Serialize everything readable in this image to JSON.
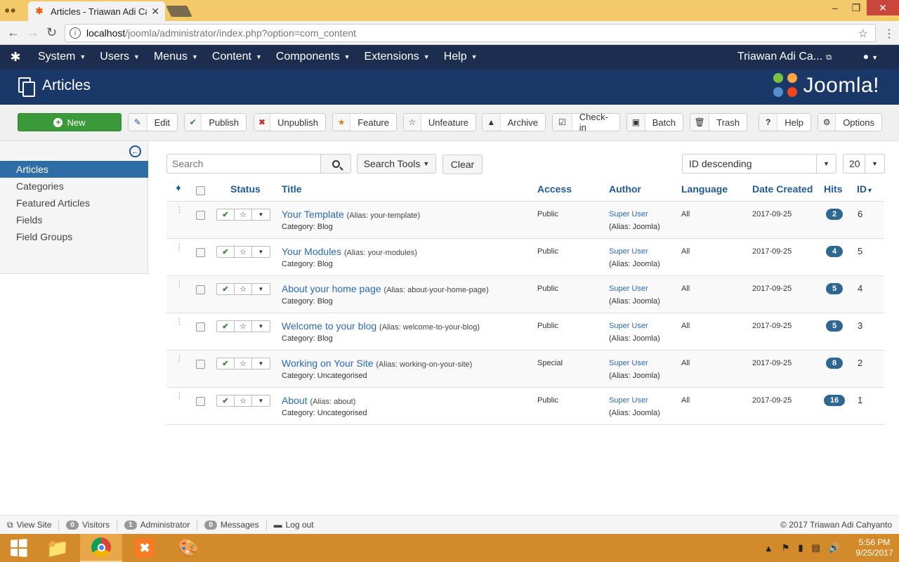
{
  "browser": {
    "tab_title": "Articles - Triawan Adi Ca",
    "url_host": "localhost",
    "url_path": "/joomla/administrator/index.php?option=com_content"
  },
  "topnav": {
    "menus": [
      "System",
      "Users",
      "Menus",
      "Content",
      "Components",
      "Extensions",
      "Help"
    ],
    "user": "Triawan Adi Ca..."
  },
  "header": {
    "title": "Articles",
    "brand": "Joomla!"
  },
  "toolbar": {
    "new": "New",
    "edit": "Edit",
    "publish": "Publish",
    "unpublish": "Unpublish",
    "feature": "Feature",
    "unfeature": "Unfeature",
    "archive": "Archive",
    "checkin": "Check-in",
    "batch": "Batch",
    "trash": "Trash",
    "help": "Help",
    "options": "Options"
  },
  "sidebar": {
    "items": [
      "Articles",
      "Categories",
      "Featured Articles",
      "Fields",
      "Field Groups"
    ],
    "active": "Articles"
  },
  "filters": {
    "search_placeholder": "Search",
    "search_tools": "Search Tools",
    "clear": "Clear",
    "sort": "ID descending",
    "limit": "20"
  },
  "table": {
    "headers": {
      "status": "Status",
      "title": "Title",
      "access": "Access",
      "author": "Author",
      "language": "Language",
      "date": "Date Created",
      "hits": "Hits",
      "id": "ID"
    },
    "rows": [
      {
        "title": "Your Template",
        "alias": "(Alias: your-template)",
        "category": "Category: Blog",
        "access": "Public",
        "author": "Super User",
        "author_alias": "(Alias: Joomla)",
        "language": "All",
        "date": "2017-09-25",
        "hits": "2",
        "id": "6"
      },
      {
        "title": "Your Modules",
        "alias": "(Alias: your-modules)",
        "category": "Category: Blog",
        "access": "Public",
        "author": "Super User",
        "author_alias": "(Alias: Joomla)",
        "language": "All",
        "date": "2017-09-25",
        "hits": "4",
        "id": "5"
      },
      {
        "title": "About your home page",
        "alias": "(Alias: about-your-home-page)",
        "category": "Category: Blog",
        "access": "Public",
        "author": "Super User",
        "author_alias": "(Alias: Joomla)",
        "language": "All",
        "date": "2017-09-25",
        "hits": "5",
        "id": "4"
      },
      {
        "title": "Welcome to your blog",
        "alias": "(Alias: welcome-to-your-blog)",
        "category": "Category: Blog",
        "access": "Public",
        "author": "Super User",
        "author_alias": "(Alias: Joomla)",
        "language": "All",
        "date": "2017-09-25",
        "hits": "5",
        "id": "3"
      },
      {
        "title": "Working on Your Site",
        "alias": "(Alias: working-on-your-site)",
        "category": "Category: Uncategorised",
        "access": "Special",
        "author": "Super User",
        "author_alias": "(Alias: Joomla)",
        "language": "All",
        "date": "2017-09-25",
        "hits": "8",
        "id": "2"
      },
      {
        "title": "About",
        "alias": "(Alias: about)",
        "category": "Category: Uncategorised",
        "access": "Public",
        "author": "Super User",
        "author_alias": "(Alias: Joomla)",
        "language": "All",
        "date": "2017-09-25",
        "hits": "16",
        "id": "1"
      }
    ]
  },
  "statusbar": {
    "view_site": "View Site",
    "visitors_count": "0",
    "visitors": "Visitors",
    "admin_count": "1",
    "admin": "Administrator",
    "messages_count": "0",
    "messages": "Messages",
    "logout": "Log out",
    "copyright": "© 2017 Triawan Adi Cahyanto"
  },
  "taskbar": {
    "time": "5:56 PM",
    "date": "9/25/2017"
  },
  "colors": {
    "topnav": "#1c2d4f",
    "header": "#1a3867",
    "new_button": "#3a9a3a",
    "link": "#2a69b8",
    "taskbar": "#d38a2a"
  }
}
